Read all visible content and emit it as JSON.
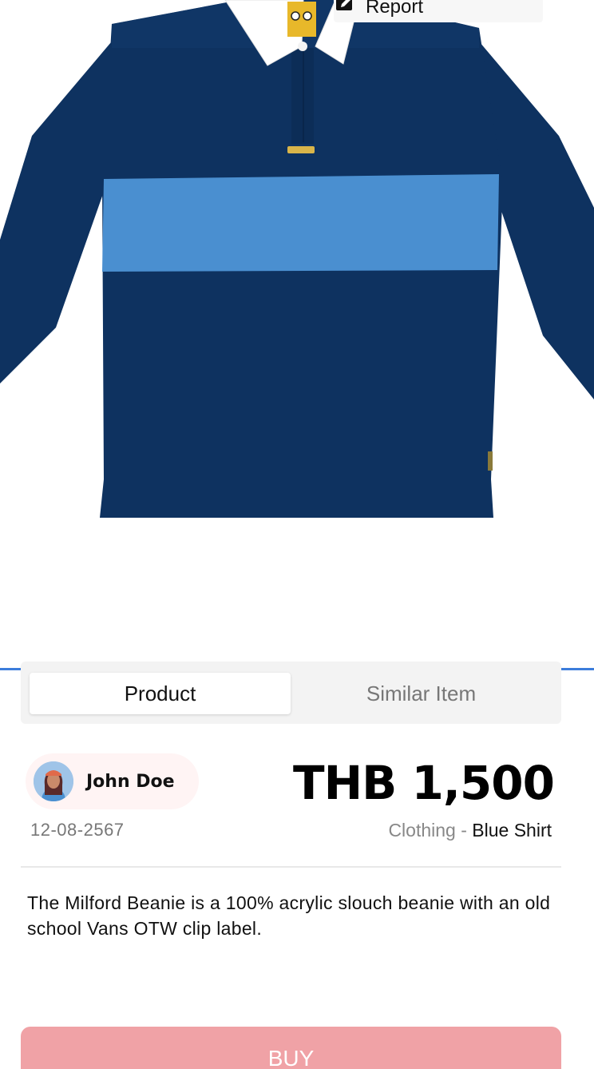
{
  "header": {
    "report_label": "Report",
    "report_icon": "edit-icon"
  },
  "product_image": {
    "description_colors": {
      "body": "#0e3260",
      "stripe": "#4a8fd0",
      "collar": "#ffffff"
    }
  },
  "tabs": [
    {
      "label": "Product",
      "active": true
    },
    {
      "label": "Similar Item",
      "active": false
    }
  ],
  "seller": {
    "name": "John Doe",
    "date": "12-08-2567",
    "avatar_icon": "user-avatar-icon"
  },
  "listing": {
    "price": "THB 1,500",
    "category": "Clothing",
    "separator": " - ",
    "item_name": "Blue Shirt",
    "description": "The Milford Beanie is a 100% acrylic slouch beanie with an old school Vans OTW clip label."
  },
  "actions": {
    "buy_label": "BUY"
  },
  "colors": {
    "accent_blue": "#3c7ddb",
    "buy_button": "#f0a2a6",
    "seller_chip": "#fff4f4"
  }
}
